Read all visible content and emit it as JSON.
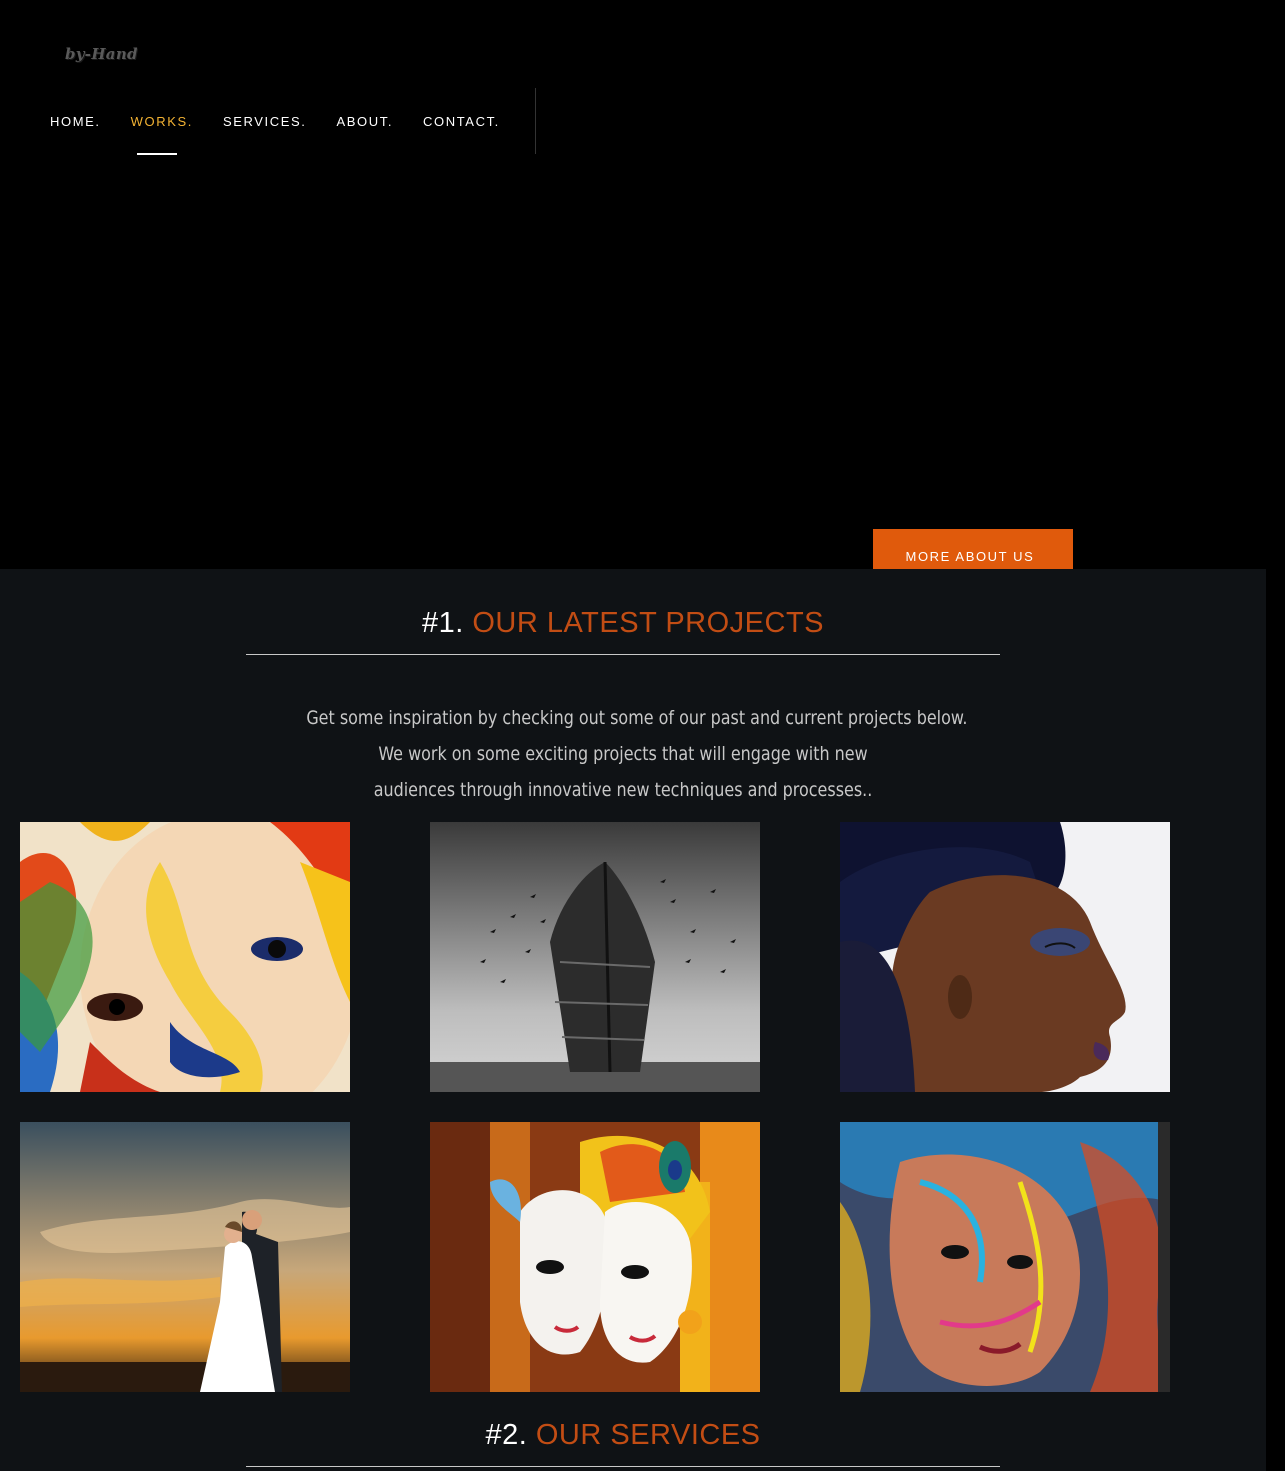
{
  "brand": {
    "logo_text": "by-Hand"
  },
  "nav": {
    "items": [
      {
        "label": "HOME.",
        "active": false
      },
      {
        "label": "WORKS.",
        "active": true
      },
      {
        "label": "SERVICES.",
        "active": false
      },
      {
        "label": "ABOUT.",
        "active": false
      },
      {
        "label": "CONTACT.",
        "active": false
      }
    ]
  },
  "hero": {
    "button_label": "MORE ABOUT US"
  },
  "projects": {
    "number": "#1.",
    "title": "OUR LATEST PROJECTS",
    "intro": [
      "Get some inspiration by checking out some of our past and current projects below.",
      "We work on some exciting projects that will engage with new",
      "audiences through innovative new techniques and processes.."
    ],
    "tiles": [
      {
        "subject": "colorful-painted-face"
      },
      {
        "subject": "black-white-shipwreck-birds"
      },
      {
        "subject": "profile-woman-blue-makeup"
      },
      {
        "subject": "wedding-couple-sunset"
      },
      {
        "subject": "krishna-radha-painting"
      },
      {
        "subject": "graffiti-colorful-face"
      }
    ]
  },
  "services": {
    "number": "#2.",
    "title": "OUR SERVICES"
  },
  "colors": {
    "accent": "#e05a0c",
    "nav_active": "#f2b233",
    "heading_accent": "#c24d14",
    "section_bg": "#0f1215"
  }
}
